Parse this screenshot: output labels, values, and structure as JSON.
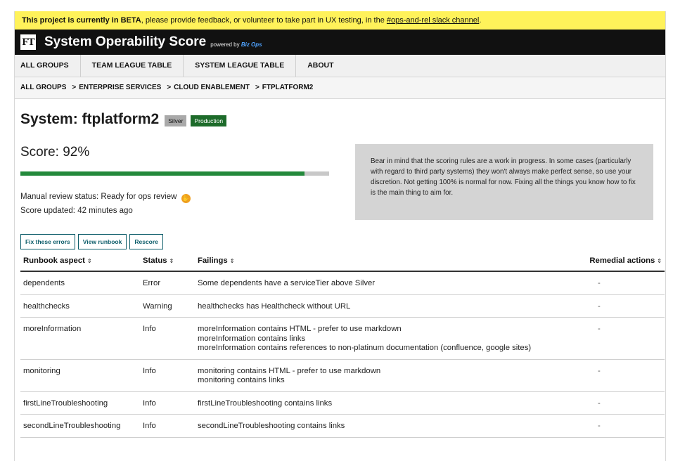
{
  "beta": {
    "strong": "This project is currently in BETA",
    "text": ", please provide feedback, or volunteer to take part in UX testing, in the ",
    "link": "#ops-and-rel slack channel",
    "end": "."
  },
  "header": {
    "logo": "FT",
    "title": "System Operability Score",
    "powered_prefix": "powered by",
    "powered_brand": "Biz Ops"
  },
  "nav": [
    "ALL GROUPS",
    "TEAM LEAGUE TABLE",
    "SYSTEM LEAGUE TABLE",
    "ABOUT"
  ],
  "breadcrumb": {
    "items": [
      "ALL GROUPS",
      "ENTERPRISE SERVICES",
      "CLOUD ENABLEMENT",
      "FTPLATFORM2"
    ],
    "separator": ">"
  },
  "page": {
    "title": "System: ftplatform2",
    "badges": [
      "Silver",
      "Production"
    ]
  },
  "score": {
    "label": "Score: 92%",
    "value_percent": 92,
    "review_status": "Manual review status: Ready for ops review",
    "updated": "Score updated: 42 minutes ago"
  },
  "note": "Bear in mind that the scoring rules are a work in progress. In some cases (particularly with regard to third party systems) they won't always make perfect sense, so use your discretion. Not getting 100% is normal for now. Fixing all the things you know how to fix is the main thing to aim for.",
  "buttons": [
    "Fix these errors",
    "View runbook",
    "Rescore"
  ],
  "table": {
    "headers": [
      "Runbook aspect",
      "Status",
      "Failings",
      "Remedial actions"
    ],
    "sort_glyph": "⇕",
    "rows": [
      {
        "aspect": "dependents",
        "status": "Error",
        "failings": [
          "Some dependents have a serviceTier above Silver"
        ],
        "remedial": "-"
      },
      {
        "aspect": "healthchecks",
        "status": "Warning",
        "failings": [
          "healthchecks has Healthcheck without URL"
        ],
        "remedial": "-"
      },
      {
        "aspect": "moreInformation",
        "status": "Info",
        "failings": [
          "moreInformation contains HTML - prefer to use markdown",
          "moreInformation contains links",
          "moreInformation contains references to non-platinum documentation (confluence, google sites)"
        ],
        "remedial": "-"
      },
      {
        "aspect": "monitoring",
        "status": "Info",
        "failings": [
          "monitoring contains HTML - prefer to use markdown",
          "monitoring contains links"
        ],
        "remedial": "-"
      },
      {
        "aspect": "firstLineTroubleshooting",
        "status": "Info",
        "failings": [
          "firstLineTroubleshooting contains links"
        ],
        "remedial": "-"
      },
      {
        "aspect": "secondLineTroubleshooting",
        "status": "Info",
        "failings": [
          "secondLineTroubleshooting contains links"
        ],
        "remedial": "-"
      }
    ]
  }
}
